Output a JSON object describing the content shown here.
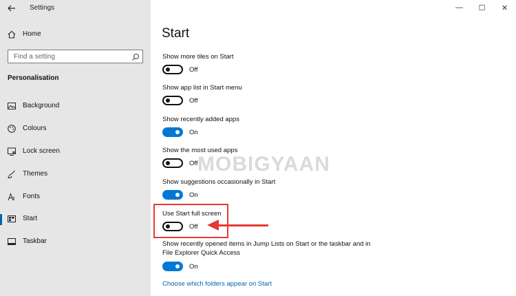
{
  "window": {
    "title": "Settings",
    "controls": {
      "minimize": "—",
      "maximize": "☐",
      "close": "✕"
    }
  },
  "sidebar": {
    "home_label": "Home",
    "search": {
      "placeholder": "Find a setting"
    },
    "section_title": "Personalisation",
    "items": [
      {
        "label": "Background",
        "icon": "picture-icon"
      },
      {
        "label": "Colours",
        "icon": "palette-icon"
      },
      {
        "label": "Lock screen",
        "icon": "lock-screen-icon"
      },
      {
        "label": "Themes",
        "icon": "brush-icon"
      },
      {
        "label": "Fonts",
        "icon": "font-icon"
      },
      {
        "label": "Start",
        "icon": "start-icon",
        "active": true
      },
      {
        "label": "Taskbar",
        "icon": "taskbar-icon"
      }
    ]
  },
  "main": {
    "title": "Start",
    "settings": [
      {
        "label": "Show more tiles on Start",
        "state": "Off"
      },
      {
        "label": "Show app list in Start menu",
        "state": "Off"
      },
      {
        "label": "Show recently added apps",
        "state": "On"
      },
      {
        "label": "Show the most used apps",
        "state": "Off"
      },
      {
        "label": "Show suggestions occasionally in Start",
        "state": "On"
      },
      {
        "label": "Use Start full screen",
        "state": "Off"
      },
      {
        "label_line1": "Show recently opened items in Jump Lists on Start or the taskbar and in",
        "label_line2": "File Explorer Quick Access",
        "state": "On"
      }
    ],
    "link": "Choose which folders appear on Start"
  },
  "watermark": "MOBIGYAAN",
  "colors": {
    "accent": "#0078d4",
    "annotation": "#e53935",
    "sidebar_bg": "#e6e6e6"
  }
}
